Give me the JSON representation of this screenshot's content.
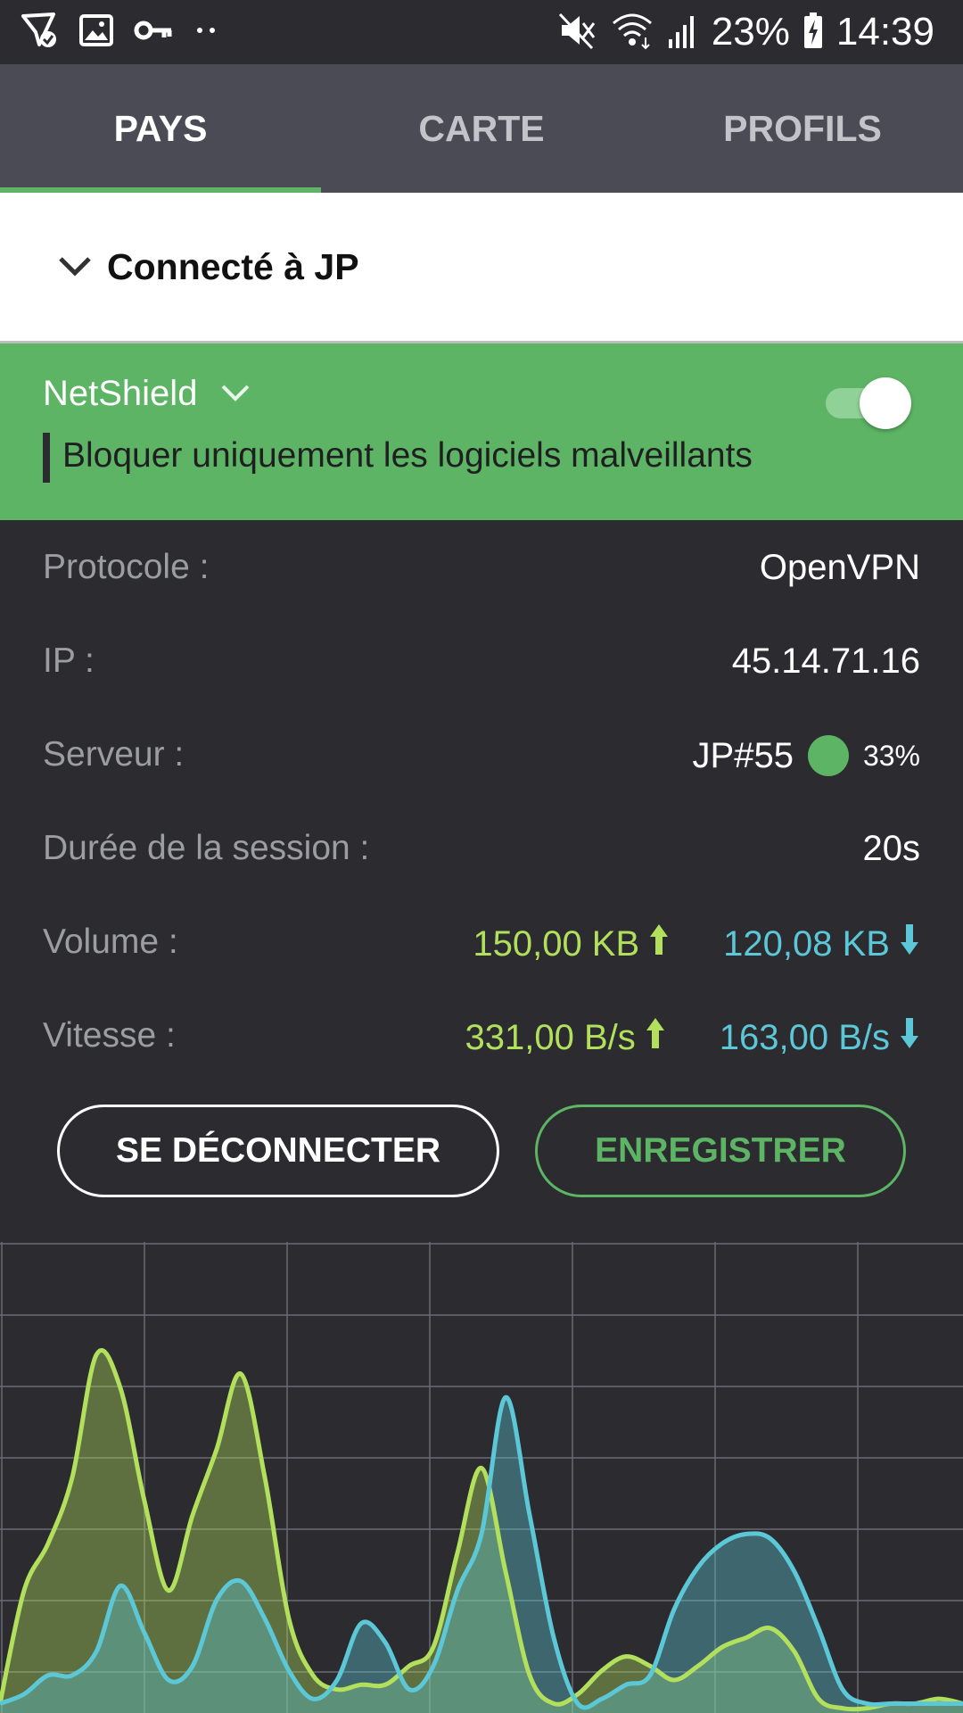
{
  "status_bar": {
    "battery_percent": "23%",
    "time": "14:39",
    "left_icons": [
      "send-check-icon",
      "image-icon",
      "vpn-key-icon",
      "more-dots-icon"
    ],
    "right_icons": [
      "mute-icon",
      "wifi-icon",
      "signal-icon",
      "battery-charging-icon"
    ]
  },
  "tabs": [
    {
      "label": "PAYS",
      "active": true
    },
    {
      "label": "CARTE",
      "active": false
    },
    {
      "label": "PROFILS",
      "active": false
    }
  ],
  "connection": {
    "title": "Connecté à JP"
  },
  "netshield": {
    "title": "NetShield",
    "description": "Bloquer uniquement les logiciels malveillants",
    "enabled": true
  },
  "info": {
    "protocol_label": "Protocole :",
    "protocol_value": "OpenVPN",
    "ip_label": "IP :",
    "ip_value": "45.14.71.16",
    "server_label": "Serveur :",
    "server_value": "JP#55",
    "server_load": "33%",
    "session_label": "Durée de la session :",
    "session_value": "20s",
    "volume_label": "Volume :",
    "volume_up": "150,00 KB",
    "volume_down": "120,08 KB",
    "speed_label": "Vitesse :",
    "speed_up": "331,00 B/s",
    "speed_down": "163,00 B/s"
  },
  "buttons": {
    "disconnect": "SE DÉCONNECTER",
    "save": "ENREGISTRER"
  },
  "colors": {
    "accent_green": "#5cb464",
    "upload_lime": "#b2e05c",
    "download_cyan": "#5cc7d6",
    "background": "#2b2b30",
    "tab_bar": "#4a4b55"
  },
  "chart_data": {
    "type": "area",
    "title": "",
    "xlabel": "",
    "ylabel": "",
    "x": [
      0,
      1,
      2,
      3,
      4,
      5,
      6,
      7,
      8,
      9,
      10,
      11,
      12,
      13,
      14,
      15,
      16,
      17,
      18,
      19,
      20,
      21,
      22,
      23,
      24,
      25,
      26,
      27,
      28,
      29,
      30,
      31,
      32,
      33,
      34,
      35,
      36,
      37,
      38,
      39,
      40
    ],
    "ylim": [
      0,
      1
    ],
    "grid": true,
    "series": [
      {
        "color": "#b2e05c",
        "values": [
          0.02,
          0.26,
          0.36,
          0.5,
          0.76,
          0.69,
          0.45,
          0.26,
          0.42,
          0.56,
          0.72,
          0.5,
          0.2,
          0.08,
          0.05,
          0.06,
          0.06,
          0.1,
          0.14,
          0.34,
          0.52,
          0.3,
          0.08,
          0.02,
          0.04,
          0.09,
          0.12,
          0.1,
          0.07,
          0.1,
          0.14,
          0.16,
          0.18,
          0.13,
          0.03,
          0.01,
          0.01,
          0.02,
          0.02,
          0.03,
          0.02
        ]
      },
      {
        "color": "#5cc7d6",
        "values": [
          0.02,
          0.04,
          0.08,
          0.08,
          0.13,
          0.27,
          0.17,
          0.07,
          0.1,
          0.24,
          0.28,
          0.2,
          0.09,
          0.03,
          0.07,
          0.19,
          0.15,
          0.05,
          0.1,
          0.26,
          0.38,
          0.67,
          0.42,
          0.16,
          0.02,
          0.03,
          0.06,
          0.08,
          0.22,
          0.31,
          0.36,
          0.38,
          0.37,
          0.3,
          0.18,
          0.05,
          0.02,
          0.02,
          0.02,
          0.02,
          0.02
        ]
      }
    ]
  }
}
